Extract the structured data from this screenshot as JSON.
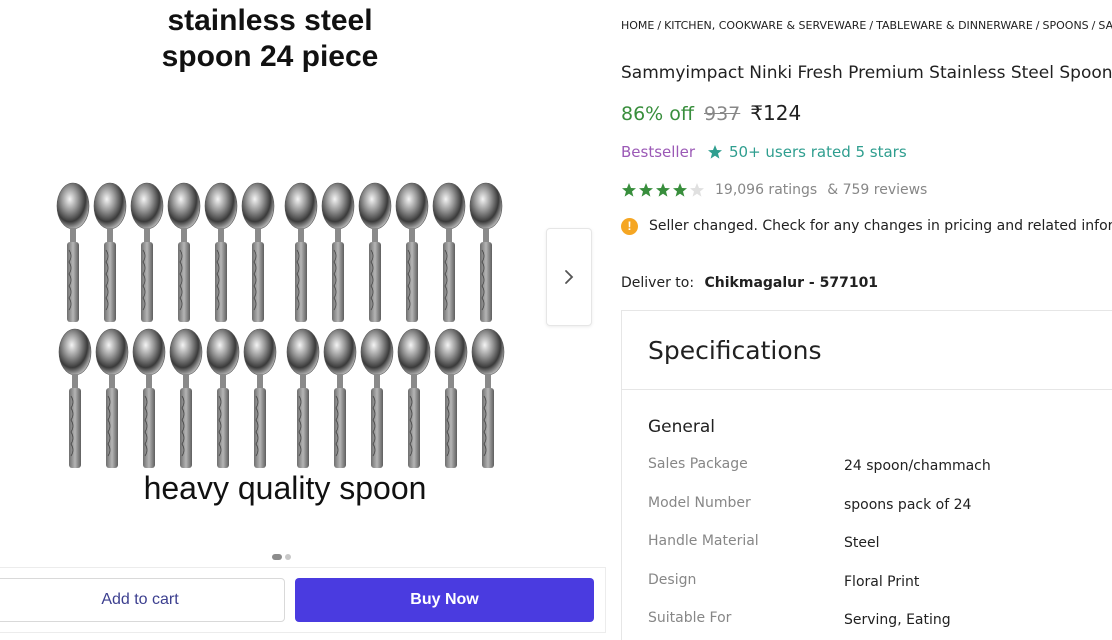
{
  "gallery": {
    "caption_line1": "stainless steel",
    "caption_line2": "spoon 24 piece",
    "caption_bottom": "heavy quality spoon",
    "next_icon": "chevron-right-icon",
    "slides": 2,
    "active_slide": 1
  },
  "actions": {
    "add_to_cart": "Add to cart",
    "buy_now": "Buy Now"
  },
  "breadcrumb": [
    "HOME",
    "KITCHEN, COOKWARE & SERVEWARE",
    "TABLEWARE & DINNERWARE",
    "SPOONS",
    "SAMMYIMPACT SPOONS"
  ],
  "product": {
    "title": "Sammyimpact Ninki Fresh Premium Stainless Steel Spoon Set",
    "discount": "86% off",
    "mrp": "937",
    "price": "₹124",
    "bestseller": "Bestseller",
    "rated_badge": "50+ users rated 5 stars",
    "star_rating": 4,
    "ratings_text": "19,096 ratings",
    "reviews_text": "& 759 reviews",
    "notice": "Seller changed. Check for any changes in pricing and related information",
    "deliver_label": "Deliver to:",
    "deliver_value": "Chikmagalur - 577101"
  },
  "specifications": {
    "heading": "Specifications",
    "group": "General",
    "rows": [
      {
        "key": "Sales Package",
        "value": "24 spoon/chammach"
      },
      {
        "key": "Model Number",
        "value": "spoons pack of 24"
      },
      {
        "key": "Handle Material",
        "value": "Steel"
      },
      {
        "key": "Design",
        "value": "Floral Print"
      },
      {
        "key": "Suitable For",
        "value": "Serving, Eating"
      }
    ]
  },
  "colors": {
    "accent_buy": "#4a3be0",
    "discount_green": "#388e3c",
    "star_green": "#388e3c",
    "bestseller_purple": "#9b59b6",
    "rated_teal": "#2f9e8f",
    "notice_orange": "#f5a623"
  }
}
